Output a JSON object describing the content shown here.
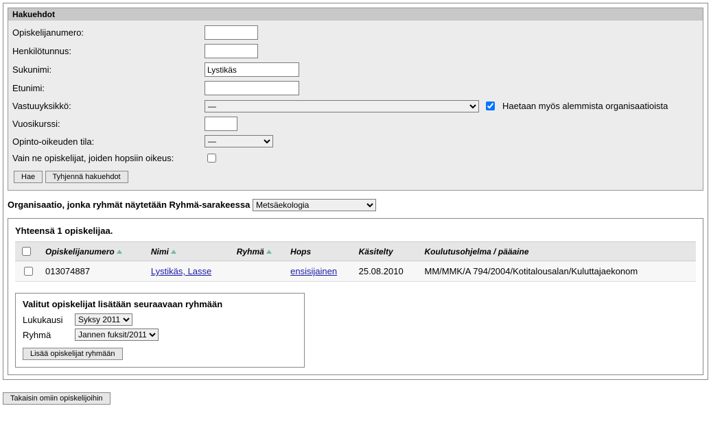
{
  "search": {
    "header": "Hakuehdot",
    "labels": {
      "studentNumber": "Opiskelijanumero:",
      "ssn": "Henkilötunnus:",
      "lastname": "Sukunimi:",
      "firstname": "Etunimi:",
      "unit": "Vastuuyksikkö:",
      "year": "Vuosikurssi:",
      "studyStatus": "Opinto-oikeuden tila:",
      "onlyHops": "Vain ne opiskelijat, joiden hopsiin oikeus:"
    },
    "values": {
      "studentNumber": "",
      "ssn": "",
      "lastname": "Lystikäs",
      "firstname": "",
      "unit": "—",
      "year": "",
      "studyStatus": "—",
      "subOrgs": true,
      "onlyHops": false
    },
    "subOrgsLabel": "Haetaan myös alemmista organisaatioista",
    "buttons": {
      "search": "Hae",
      "clear": "Tyhjennä hakuehdot"
    }
  },
  "orgFilter": {
    "label": "Organisaatio, jonka ryhmät näytetään Ryhmä-sarakeessa",
    "selected": "Metsäekologia"
  },
  "results": {
    "summary": "Yhteensä 1 opiskelijaa.",
    "columns": {
      "studentNumber": "Opiskelijanumero",
      "name": "Nimi",
      "group": "Ryhmä",
      "hops": "Hops",
      "processed": "Käsitelty",
      "programme": "Koulutusohjelma / pääaine"
    },
    "rows": [
      {
        "studentNumber": "013074887",
        "name": "Lystikäs, Lasse",
        "group": "",
        "hops": "ensisijainen",
        "processed": "25.08.2010",
        "programme": "MM/MMK/A 794/2004/Kotitalousalan/Kuluttajaekonom"
      }
    ]
  },
  "addPanel": {
    "title": "Valitut opiskelijat lisätään seuraavaan ryhmään",
    "semesterLabel": "Lukukausi",
    "semesterValue": "Syksy 2011",
    "groupLabel": "Ryhmä",
    "groupValue": "Jannen fuksit/2011",
    "addButton": "Lisää opiskelijat ryhmään"
  },
  "backButton": "Takaisin omiin opiskelijoihin"
}
